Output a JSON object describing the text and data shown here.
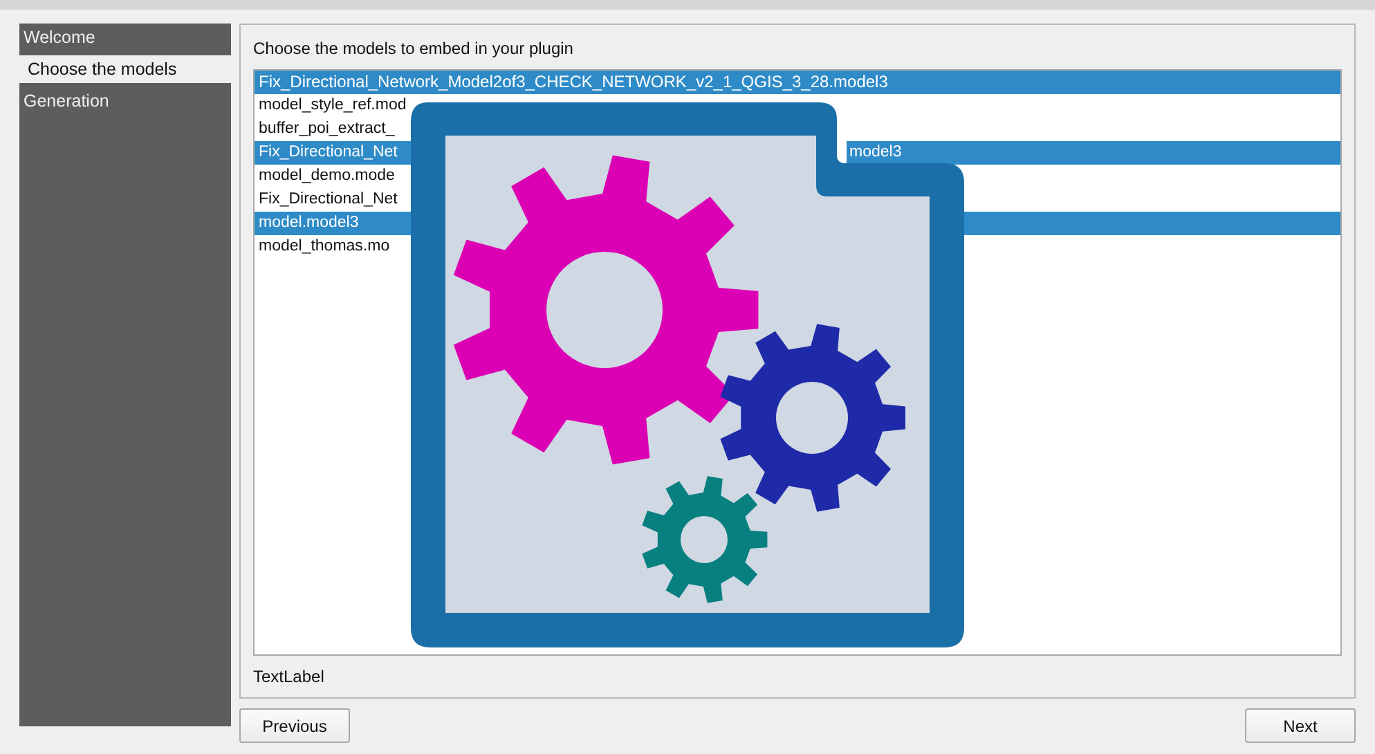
{
  "sidebar": {
    "items": [
      {
        "label": "Welcome",
        "selected": false
      },
      {
        "label": "Choose the models",
        "selected": true
      },
      {
        "label": "Generation",
        "selected": false
      }
    ]
  },
  "page": {
    "heading": "Choose the models to embed in your plugin",
    "models": [
      {
        "text": "Fix_Directional_Network_Model2of3_CHECK_NETWORK_v2_1_QGIS_3_28.model3",
        "selected": true
      },
      {
        "text": "model_style_ref.mod",
        "selected": false
      },
      {
        "text": "buffer_poi_extract_",
        "selected": false
      },
      {
        "text": "Fix_Directional_Net",
        "tail": "model3",
        "selected": true
      },
      {
        "text": "model_demo.mode",
        "selected": false
      },
      {
        "text": "Fix_Directional_Net",
        "selected": false
      },
      {
        "text": "model.model3",
        "selected": true
      },
      {
        "text": "model_thomas.mo",
        "selected": false
      }
    ],
    "status_label": "TextLabel"
  },
  "buttons": {
    "previous": "Previous",
    "next": "Next"
  }
}
